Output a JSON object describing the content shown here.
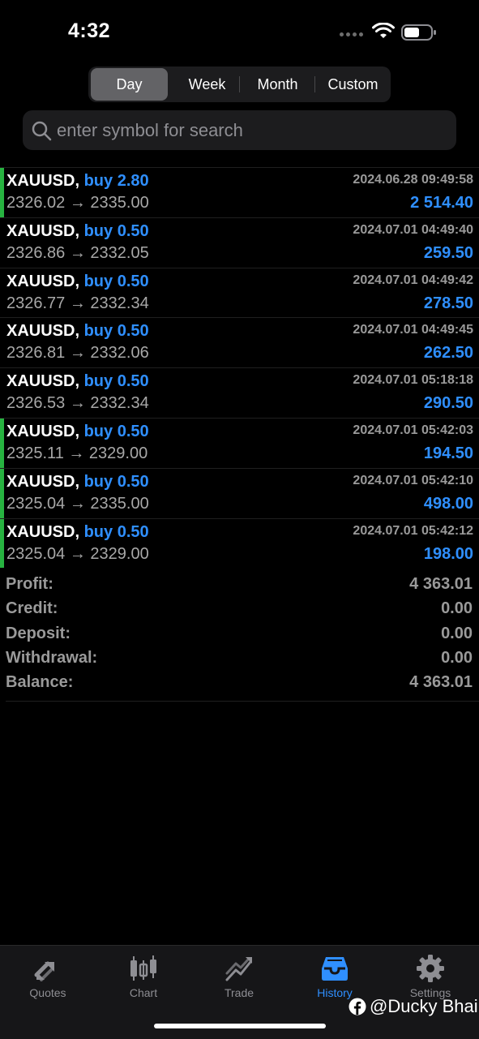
{
  "status": {
    "time": "4:32"
  },
  "period_tabs": [
    {
      "label": "Day",
      "active": true
    },
    {
      "label": "Week",
      "active": false
    },
    {
      "label": "Month",
      "active": false
    },
    {
      "label": "Custom",
      "active": false
    }
  ],
  "search": {
    "placeholder": "enter symbol for search",
    "value": ""
  },
  "deals": [
    {
      "symbol": "XAUUSD,",
      "side": "buy 2.80",
      "time": "2024.06.28 09:49:58",
      "prices": "2326.02 → 2335.00",
      "profit": "2 514.40",
      "marker": true
    },
    {
      "symbol": "XAUUSD,",
      "side": "buy 0.50",
      "time": "2024.07.01 04:49:40",
      "prices": "2326.86 → 2332.05",
      "profit": "259.50",
      "marker": false
    },
    {
      "symbol": "XAUUSD,",
      "side": "buy 0.50",
      "time": "2024.07.01 04:49:42",
      "prices": "2326.77 → 2332.34",
      "profit": "278.50",
      "marker": false
    },
    {
      "symbol": "XAUUSD,",
      "side": "buy 0.50",
      "time": "2024.07.01 04:49:45",
      "prices": "2326.81 → 2332.06",
      "profit": "262.50",
      "marker": false
    },
    {
      "symbol": "XAUUSD,",
      "side": "buy 0.50",
      "time": "2024.07.01 05:18:18",
      "prices": "2326.53 → 2332.34",
      "profit": "290.50",
      "marker": false
    },
    {
      "symbol": "XAUUSD,",
      "side": "buy 0.50",
      "time": "2024.07.01 05:42:03",
      "prices": "2325.11 → 2329.00",
      "profit": "194.50",
      "marker": true
    },
    {
      "symbol": "XAUUSD,",
      "side": "buy 0.50",
      "time": "2024.07.01 05:42:10",
      "prices": "2325.04 → 2335.00",
      "profit": "498.00",
      "marker": true
    },
    {
      "symbol": "XAUUSD,",
      "side": "buy 0.50",
      "time": "2024.07.01 05:42:12",
      "prices": "2325.04 → 2329.00",
      "profit": "198.00",
      "marker": true
    }
  ],
  "summary": [
    {
      "label": "Profit:",
      "value": "4 363.01"
    },
    {
      "label": "Credit:",
      "value": "0.00"
    },
    {
      "label": "Deposit:",
      "value": "0.00"
    },
    {
      "label": "Withdrawal:",
      "value": "0.00"
    },
    {
      "label": "Balance:",
      "value": "4 363.01"
    }
  ],
  "tabbar": [
    {
      "label": "Quotes",
      "icon": "quotes-icon",
      "active": false
    },
    {
      "label": "Chart",
      "icon": "chart-icon",
      "active": false
    },
    {
      "label": "Trade",
      "icon": "trade-icon",
      "active": false
    },
    {
      "label": "History",
      "icon": "history-icon",
      "active": true
    },
    {
      "label": "Settings",
      "icon": "settings-icon",
      "active": false
    }
  ],
  "watermark": "@Ducky Bhai",
  "colors": {
    "accent": "#2f8fff",
    "marker": "#27b340",
    "muted": "#9a9a9a",
    "background": "#000000"
  }
}
